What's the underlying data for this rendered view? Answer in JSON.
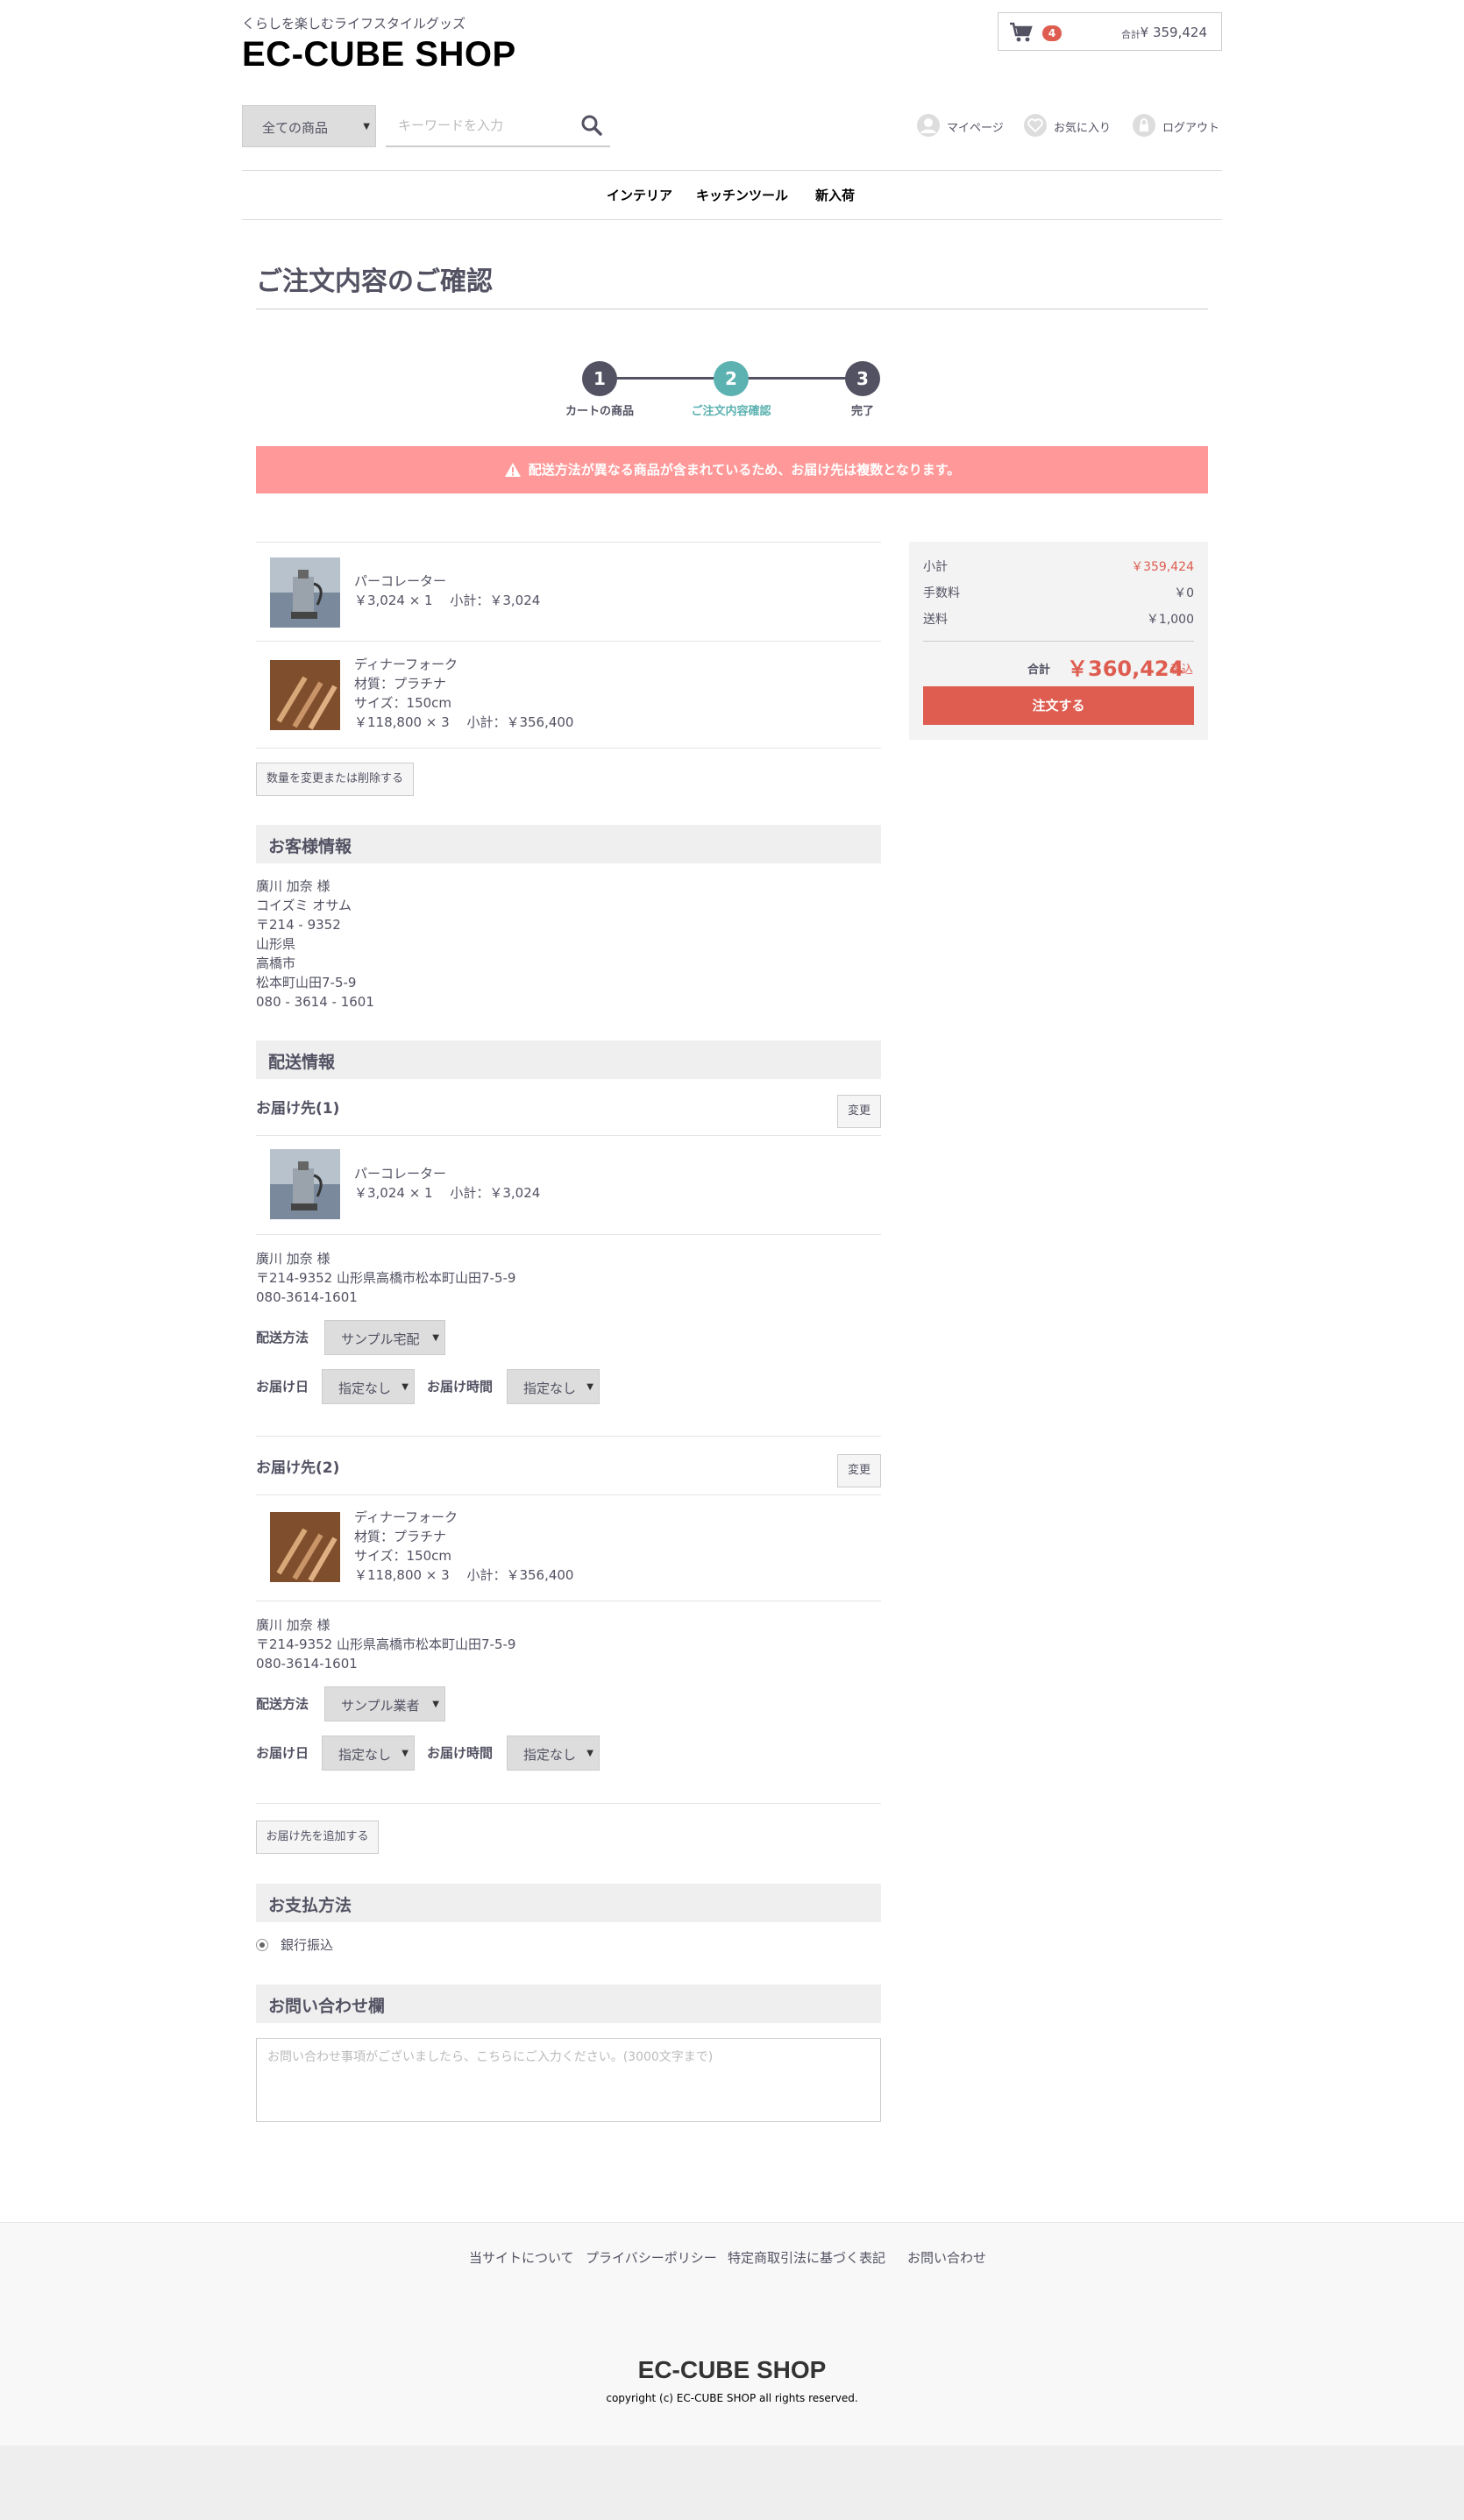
{
  "header": {
    "tagline": "くらしを楽しむライフスタイルグッズ",
    "logo": "EC-CUBE SHOP",
    "cart": {
      "count": "4",
      "total_label": "合計",
      "total": "¥ 359,424"
    },
    "category_select": "全ての商品",
    "search_placeholder": "キーワードを入力",
    "util": {
      "mypage": "マイページ",
      "favorite": "お気に入り",
      "logout": "ログアウト"
    },
    "nav": [
      "インテリア",
      "キッチンツール",
      "新入荷"
    ]
  },
  "page": {
    "title": "ご注文内容のご確認",
    "steps": [
      {
        "num": "1",
        "label": "カートの商品"
      },
      {
        "num": "2",
        "label": "ご注文内容確認"
      },
      {
        "num": "3",
        "label": "完了"
      }
    ],
    "alert": "配送方法が異なる商品が含まれているため、お届け先は複数となります。"
  },
  "items": [
    {
      "name": "パーコレーター",
      "price_line": "￥3,024 × 1　 小計：￥3,024"
    },
    {
      "name": "ディナーフォーク",
      "material": "材質：プラチナ",
      "size": "サイズ：150cm",
      "price_line": "￥118,800 × 3　 小計：￥356,400"
    }
  ],
  "change_button": "数量を変更または削除する",
  "customer": {
    "heading": "お客様情報",
    "lines": [
      "廣川 加奈 様",
      "コイズミ オサム",
      "〒214 - 9352",
      "山形県",
      "高橋市",
      "松本町山田7-5-9",
      "080 - 3614 - 1601"
    ]
  },
  "shipping": {
    "heading": "配送情報",
    "method_label": "配送方法",
    "date_label": "お届け日",
    "time_label": "お届け時間",
    "change_label": "変更",
    "destinations": [
      {
        "title": "お届け先(1)",
        "item_name": "パーコレーター",
        "item_price": "￥3,024 × 1　 小計：￥3,024",
        "address": [
          "廣川 加奈 様",
          "〒214-9352 山形県高橋市松本町山田7-5-9",
          "080-3614-1601"
        ],
        "method": "サンプル宅配",
        "date": "指定なし",
        "time": "指定なし"
      },
      {
        "title": "お届け先(2)",
        "item_name": "ディナーフォーク",
        "item_material": "材質：プラチナ",
        "item_size": "サイズ：150cm",
        "item_price": "￥118,800 × 3　 小計：￥356,400",
        "address": [
          "廣川 加奈 様",
          "〒214-9352 山形県高橋市松本町山田7-5-9",
          "080-3614-1601"
        ],
        "method": "サンプル業者",
        "date": "指定なし",
        "time": "指定なし"
      }
    ],
    "add_destination": "お届け先を追加する"
  },
  "payment": {
    "heading": "お支払方法",
    "option": "銀行振込"
  },
  "inquiry": {
    "heading": "お問い合わせ欄",
    "placeholder": "お問い合わせ事項がございましたら、こちらにご入力ください。(3000文字まで)"
  },
  "summary": {
    "subtotal_label": "小計",
    "subtotal": "￥359,424",
    "fee_label": "手数料",
    "fee": "￥0",
    "shipping_label": "送料",
    "shipping": "￥1,000",
    "total_label": "合計",
    "total": "￥360,424",
    "tax_label": "税込",
    "order_button": "注文する"
  },
  "footer": {
    "links": [
      "当サイトについて",
      "プライバシーポリシー",
      "特定商取引法に基づく表記",
      "お問い合わせ"
    ],
    "logo": "EC-CUBE SHOP",
    "copyright": "copyright (c) EC-CUBE SHOP all rights reserved."
  },
  "colors": {
    "accent": "#DE5D50",
    "step_active": "#5CB1B1",
    "alert": "#FF9999",
    "text": "#525263"
  }
}
